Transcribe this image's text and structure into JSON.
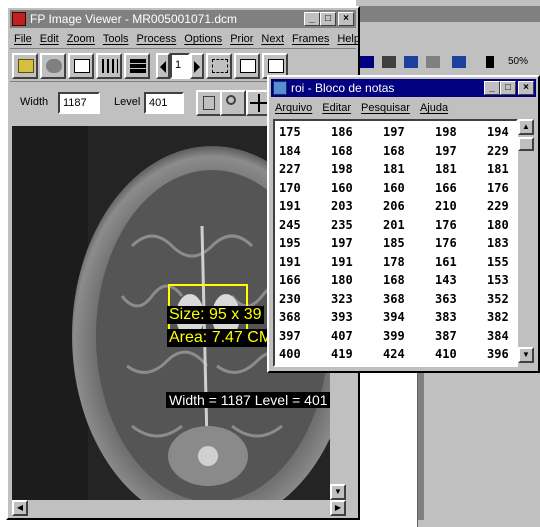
{
  "background_window": {
    "zoom_text": "50%"
  },
  "viewer": {
    "title": "FP Image Viewer - MR005001071.dcm",
    "menu": [
      "File",
      "Edit",
      "Zoom",
      "Tools",
      "Process",
      "Options",
      "Prior",
      "Next",
      "Frames",
      "Help"
    ],
    "frame_number": "1",
    "width_label": "Width",
    "width_value": "1187",
    "level_label": "Level",
    "level_value": "401",
    "overlay_size": "Size: 95 x 39",
    "overlay_area": "Area: 7.47 CM",
    "overlay_wl": "Width = 1187   Level = 401"
  },
  "notepad": {
    "title": "roi - Bloco de notas",
    "menu": [
      "Arquivo",
      "Editar",
      "Pesquisar",
      "Ajuda"
    ],
    "rows": [
      [
        "175",
        "186",
        "197",
        "198",
        "194"
      ],
      [
        "184",
        "168",
        "168",
        "197",
        "229"
      ],
      [
        "227",
        "198",
        "181",
        "181",
        "181"
      ],
      [
        "170",
        "160",
        "160",
        "166",
        "176"
      ],
      [
        "191",
        "203",
        "206",
        "210",
        "229"
      ],
      [
        "245",
        "235",
        "201",
        "176",
        "180"
      ],
      [
        "195",
        "197",
        "185",
        "176",
        "183"
      ],
      [
        "191",
        "191",
        "178",
        "161",
        "155"
      ],
      [
        "166",
        "180",
        "168",
        "143",
        "153"
      ],
      [
        "230",
        "323",
        "368",
        "363",
        "352"
      ],
      [
        "368",
        "393",
        "394",
        "383",
        "382"
      ],
      [
        "397",
        "407",
        "399",
        "387",
        "384"
      ],
      [
        "400",
        "419",
        "424",
        "410",
        "396"
      ]
    ]
  },
  "colors": {
    "inactive_title": "#808080",
    "active_title": "#000080",
    "roi_outline": "#ffff00",
    "window_face": "#c0c0c0"
  }
}
